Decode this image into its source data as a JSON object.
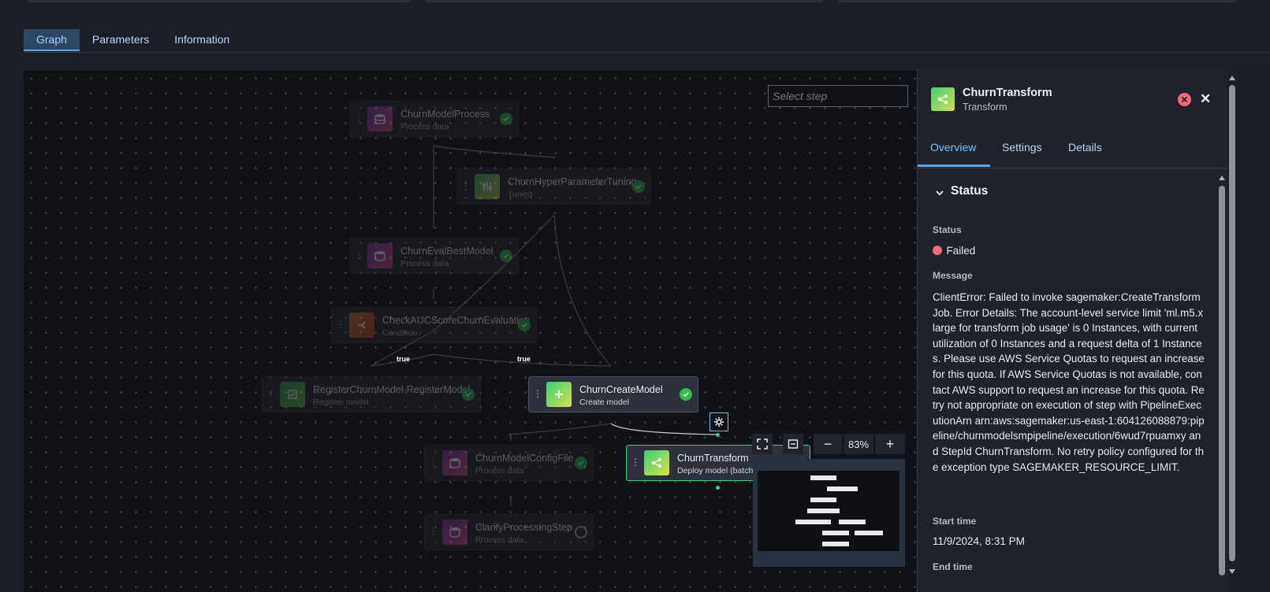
{
  "tabs": [
    "Graph",
    "Parameters",
    "Information"
  ],
  "select_step": {
    "placeholder": "Select step"
  },
  "nodes": [
    {
      "title": "ChurnModelProcess",
      "sub": "Process data"
    },
    {
      "title": "ChurnHyperParameterTuning",
      "sub": "Tuning"
    },
    {
      "title": "ChurnEvalBestModel",
      "sub": "Process data"
    },
    {
      "title": "CheckAUCScoreChurnEvaluation",
      "sub": "Condition"
    },
    {
      "title": "RegisterChurnModel-RegisterModel",
      "sub": "Register model"
    },
    {
      "title": "ChurnCreateModel",
      "sub": "Create model"
    },
    {
      "title": "ChurnModelConfigFile",
      "sub": "Process data"
    },
    {
      "title": "ClarifyProcessingStep",
      "sub": "Process data"
    },
    {
      "title": "ChurnTransform",
      "sub": "Deploy model (batch i"
    }
  ],
  "edge_labels": [
    "true",
    "true"
  ],
  "zoom": {
    "level": "83%",
    "minus": "−",
    "plus": "+"
  },
  "panel": {
    "title": "ChurnTransform",
    "subtitle": "Transform",
    "close": "✕",
    "tabs": [
      "Overview",
      "Settings",
      "Details"
    ],
    "section": "Status",
    "status_label": "Status",
    "status_value": "Failed",
    "message_label": "Message",
    "message": "ClientError: Failed to invoke sagemaker:CreateTransformJob. Error Details: The account-level service limit 'ml.m5.xlarge for transform job usage' is 0 Instances, with current utilization of 0 Instances and a request delta of 1 Instances. Please use AWS Service Quotas to request an increase for this quota. If AWS Service Quotas is not available, contact AWS support to request an increase for this quota. Retry not appropriate on execution of step with PipelineExecutionArn arn:aws:sagemaker:us-east-1:604126088879:pipeline/churnmodelsmpipeline/execution/6wud7rpuamxy and StepId ChurnTransform. No retry policy configured for the exception type SAGEMAKER_RESOURCE_LIMIT.",
    "start_label": "Start time",
    "start_value": "11/9/2024, 8:31 PM",
    "end_label": "End time"
  },
  "colors": {
    "accent": "#5aa6e6",
    "success": "#2fbf4c",
    "failed": "#f06a7a",
    "canvas": "#111217"
  },
  "icons": [
    "database-icon",
    "tuning-icon",
    "condition-icon",
    "register-icon",
    "plus-icon",
    "deploy-icon",
    "check-icon",
    "pending-icon",
    "gear-icon",
    "fullscreen-icon",
    "fit-view-icon",
    "error-icon",
    "close-icon",
    "chevron-down-icon"
  ]
}
